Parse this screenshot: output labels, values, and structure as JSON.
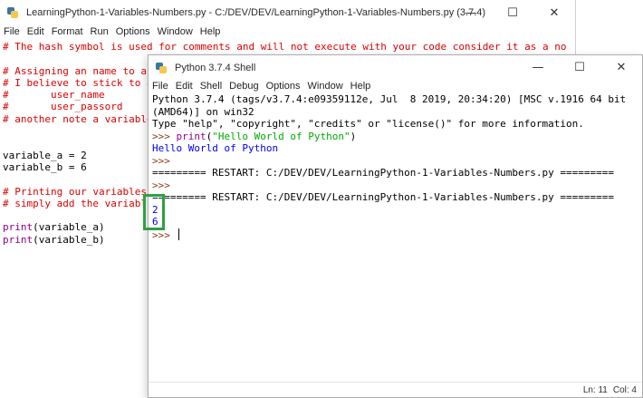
{
  "editor": {
    "title": "LearningPython-1-Variables-Numbers.py - C:/DEV/DEV/LearningPython-1-Variables-Numbers.py (3.7.4)",
    "controls": {
      "minimize": "—",
      "maximize": "☐",
      "close": "✕"
    },
    "menu": [
      "File",
      "Edit",
      "Format",
      "Run",
      "Options",
      "Window",
      "Help"
    ],
    "code_lines": [
      {
        "text": "# The hash symbol is used for comments and will not execute with your code consider it as a no",
        "type": "comment"
      },
      {
        "text": "",
        "type": "plain"
      },
      {
        "text": "# Assigning an name to a",
        "type": "comment"
      },
      {
        "text": "# I believe to stick to a",
        "type": "comment"
      },
      {
        "text": "#       user_name",
        "type": "comment"
      },
      {
        "text": "#       user_passord",
        "type": "comment"
      },
      {
        "text": "# another note a variable",
        "type": "comment"
      },
      {
        "text": "",
        "type": "plain"
      },
      {
        "text": "",
        "type": "plain"
      },
      {
        "text": "variable_a = 2",
        "type": "plain"
      },
      {
        "text": "variable_b = 6",
        "type": "plain"
      },
      {
        "text": "",
        "type": "plain"
      },
      {
        "text": "# Printing our variables",
        "type": "comment"
      },
      {
        "text": "# simply add the variabl",
        "type": "comment"
      },
      {
        "text": "",
        "type": "plain"
      },
      {
        "text": "print(variable_a)",
        "type": "builtin-call"
      },
      {
        "text": "print(variable_b)",
        "type": "builtin-call"
      }
    ]
  },
  "shell": {
    "title": "Python 3.7.4 Shell",
    "controls": {
      "minimize": "—",
      "maximize": "☐",
      "close": "✕"
    },
    "menu": [
      "File",
      "Edit",
      "Shell",
      "Debug",
      "Options",
      "Window",
      "Help"
    ],
    "lines": [
      {
        "parts": [
          {
            "text": "Python 3.7.4 (tags/v3.7.4:e09359112e, Jul  8 2019, 20:34:20) [MSC v.1916 64 bit",
            "cls": ""
          }
        ]
      },
      {
        "parts": [
          {
            "text": "(AMD64)] on win32",
            "cls": ""
          }
        ]
      },
      {
        "parts": [
          {
            "text": "Type \"help\", \"copyright\", \"credits\" or \"license()\" for more information.",
            "cls": ""
          }
        ]
      },
      {
        "parts": [
          {
            "text": ">>> ",
            "cls": "prompt"
          },
          {
            "text": "print",
            "cls": "builtin"
          },
          {
            "text": "(",
            "cls": ""
          },
          {
            "text": "\"Hello World of Python\"",
            "cls": "string"
          },
          {
            "text": ")",
            "cls": ""
          }
        ]
      },
      {
        "parts": [
          {
            "text": "Hello World of Python",
            "cls": "stdout"
          }
        ]
      },
      {
        "parts": [
          {
            "text": ">>> ",
            "cls": "prompt"
          }
        ]
      },
      {
        "parts": [
          {
            "text": "========= RESTART: C:/DEV/DEV/LearningPython-1-Variables-Numbers.py =========",
            "cls": ""
          }
        ]
      },
      {
        "parts": [
          {
            "text": ">>> ",
            "cls": "prompt"
          }
        ]
      },
      {
        "parts": [
          {
            "text": "========= RESTART: C:/DEV/DEV/LearningPython-1-Variables-Numbers.py =========",
            "cls": ""
          }
        ]
      },
      {
        "parts": [
          {
            "text": "2",
            "cls": "stdout"
          }
        ]
      },
      {
        "parts": [
          {
            "text": "6",
            "cls": "stdout"
          }
        ]
      },
      {
        "parts": [
          {
            "text": ">>> ",
            "cls": "prompt"
          }
        ],
        "cursor": true
      }
    ],
    "status": {
      "line": "Ln: 11",
      "col": "Col: 4"
    }
  },
  "colors": {
    "comment": "#dd0000",
    "builtin": "#900090",
    "string": "#00aa00",
    "stdout": "#0000ee",
    "prompt": "#8a3b11",
    "highlight": "#2ea043"
  }
}
